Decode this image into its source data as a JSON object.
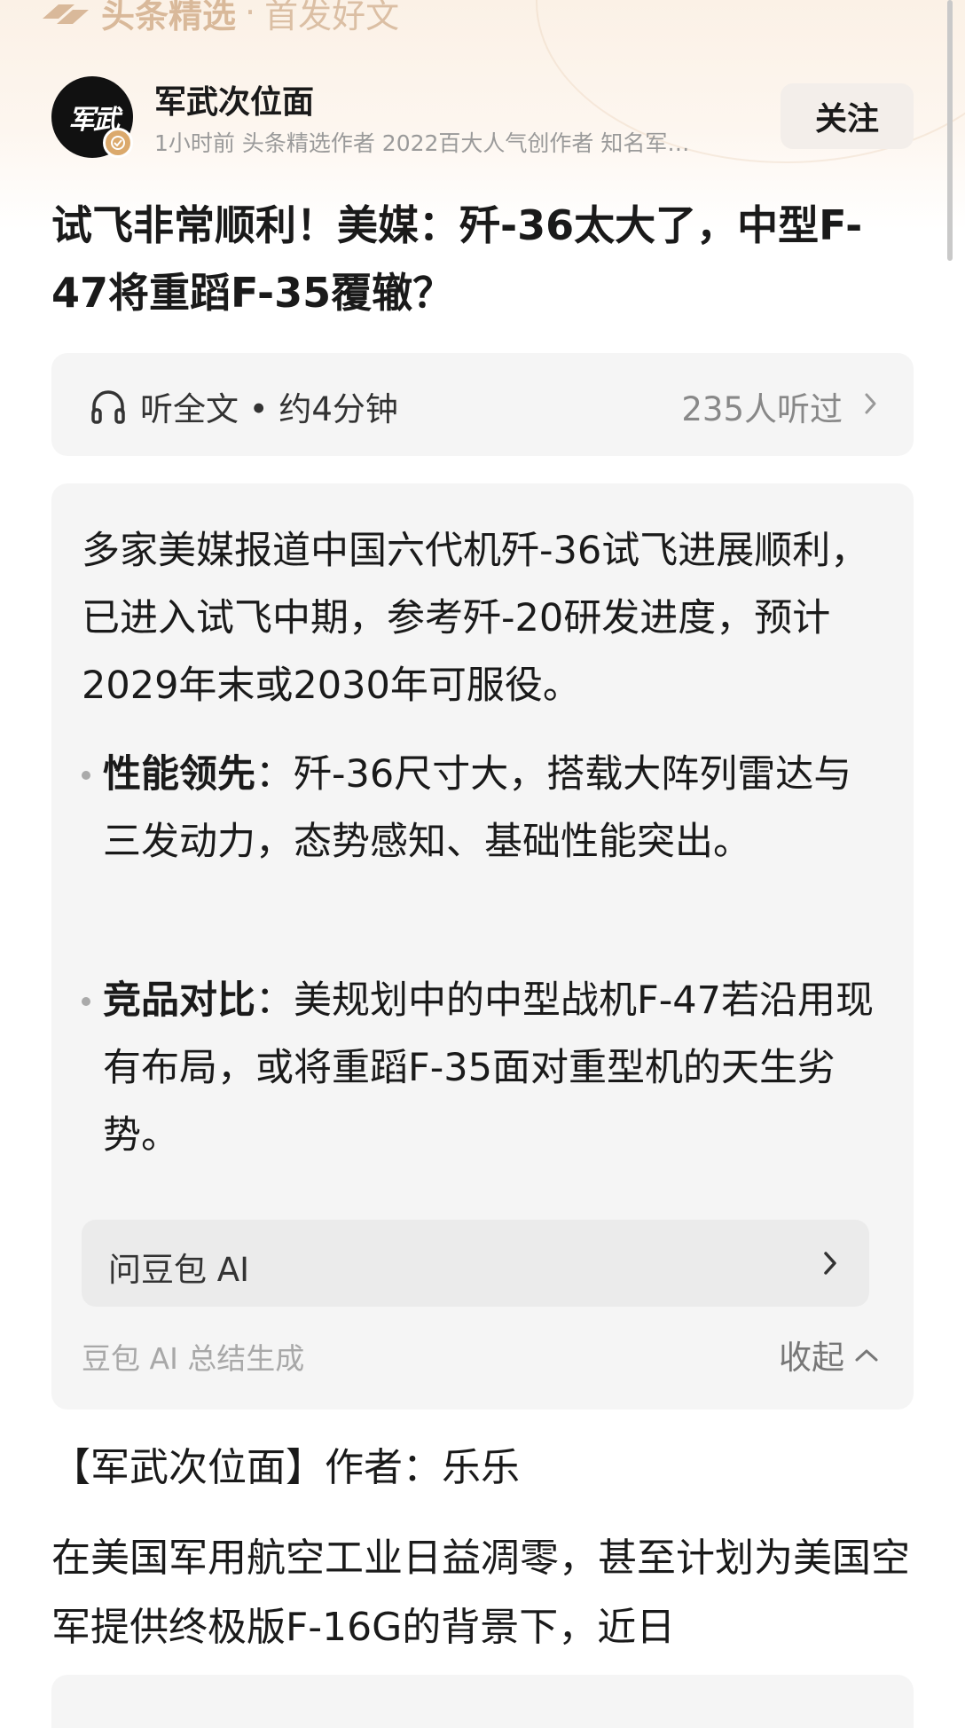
{
  "brand": {
    "name": "头条精选",
    "separator": "·",
    "subtitle": "首发好文"
  },
  "author": {
    "avatar_text": "军武",
    "name": "军武次位面",
    "meta": "1小时前   头条精选作者 2022百大人气创作者 知名军…",
    "follow_label": "关注"
  },
  "article": {
    "title": "试飞非常顺利！美媒：歼-36太大了，中型F-47将重蹈F-35覆辙？"
  },
  "listen": {
    "label": "听全文 • 约4分钟",
    "count": "235人听过"
  },
  "ai_summary": {
    "summary": "多家美媒报道中国六代机歼-36试飞进展顺利，已进入试飞中期，参考歼-20研发进度，预计2029年末或2030年可服役。",
    "points": [
      {
        "title": "性能领先",
        "text": "：歼-36尺寸大，搭载大阵列雷达与三发动力，态势感知、基础性能突出。"
      },
      {
        "title": "竞品对比",
        "text": "：美规划中的中型战机F-47若沿用现有布局，或将重蹈F-35面对重型机的天生劣势。"
      }
    ],
    "ask_label": "问豆包 AI",
    "source": "豆包 AI 总结生成",
    "collapse_label": "收起"
  },
  "body": {
    "byline": "【军武次位面】作者：乐乐",
    "paragraph": "在美国军用航空工业日益凋零，甚至计划为美国空军提供终极版F-16G的背景下，近日"
  },
  "colors": {
    "brand_gold": "#d9b99a",
    "badge_gold": "#dba96c",
    "card_bg": "#f5f5f5"
  }
}
